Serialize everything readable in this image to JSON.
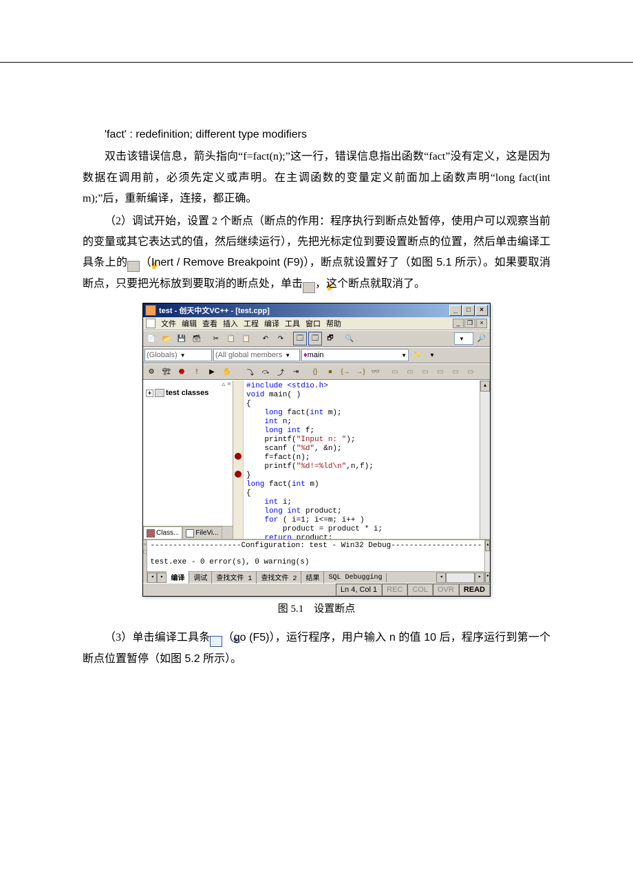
{
  "para0": "'fact' : redefinition; different type modifiers",
  "para1": "双击该错误信息，箭头指向“f=fact(n);”这一行，错误信息指出函数“fact”没有定义，这是因为数据在调用前，必须先定义或声明。在主调函数的变量定义前面加上函数声明“long fact(int m);”后，重新编译，连接，都正确。",
  "para2a": "（2）调试开始，设置 2 个断点（断点的作用：程序执行到断点处暂停，使用户可以观察当前的变量或其它表达式的值，然后继续运行），先把光标定位到要设置断点的位置，然后单击编译工具条上的",
  "para2b": "（Inert / Remove Breakpoint (F9)），断点就设置好了（如图 5.1 所示）。如果要取消断点，只要把光标放到要取消的断点处，单击",
  "para2c": "，这个断点就取消了。",
  "caption": "图 5.1　设置断点",
  "para3a": "（3）单击编译工具条",
  "para3b": "（go (F5)），运行程序，用户输入 n 的值 10 后，程序运行到第一个断点位置暂停（如图 5.2 所示）。",
  "ide": {
    "title": "test - 创天中文VC++ - [test.cpp]",
    "menus": [
      "文件",
      "编辑",
      "查看",
      "插入",
      "工程",
      "编译",
      "工具",
      "窗口",
      "帮助"
    ],
    "combo1": "(Globals)",
    "combo2": "(All global members",
    "combo3": "main",
    "tree_item": "test classes",
    "side_tab1": "Class...",
    "side_tab2": "FileVi...",
    "output_line1": "--------------------Configuration: test - Win32 Debug--------------------",
    "output_line2": "test.exe - 0 error(s), 0 warning(s)",
    "otabs": [
      "编译",
      "调试",
      "查找文件 1",
      "查找文件 2",
      "结果",
      "SQL Debugging"
    ],
    "status_pos": "Ln 4, Col 1",
    "status_rec": "REC",
    "status_col": "COL",
    "status_ovr": "OVR",
    "status_read": "READ",
    "code": {
      "l1a": "#include ",
      "l1b": "<stdio.h>",
      "l2a": "void",
      "l2b": " main( )",
      "l3": "{",
      "l4a": "    long",
      "l4b": " fact(",
      "l4c": "int",
      "l4d": " m);",
      "l5a": "    int",
      "l5b": " n;",
      "l6a": "    long int",
      "l6b": " f;",
      "l7a": "    printf(",
      "l7b": "\"Input n: \"",
      "l7c": ");",
      "l8a": "    scanf (",
      "l8b": "\"%d\"",
      "l8c": ", &n);",
      "l9": "    f=fact(n);",
      "l10a": "    printf(",
      "l10b": "\"%d!=%ld\\n\"",
      "l10c": ",n,f);",
      "l11": "}",
      "l12a": "long",
      "l12b": " fact(",
      "l12c": "int",
      "l12d": " m)",
      "l13": "{",
      "l14a": "    int",
      "l14b": " i;",
      "l15a": "    long int",
      "l15b": " product;",
      "l16a": "    for",
      "l16b": " ( i=1; i<=m; i++ )",
      "l17": "        product = product * i;",
      "l18a": "    return",
      "l18b": " product;",
      "l19": "}"
    }
  }
}
